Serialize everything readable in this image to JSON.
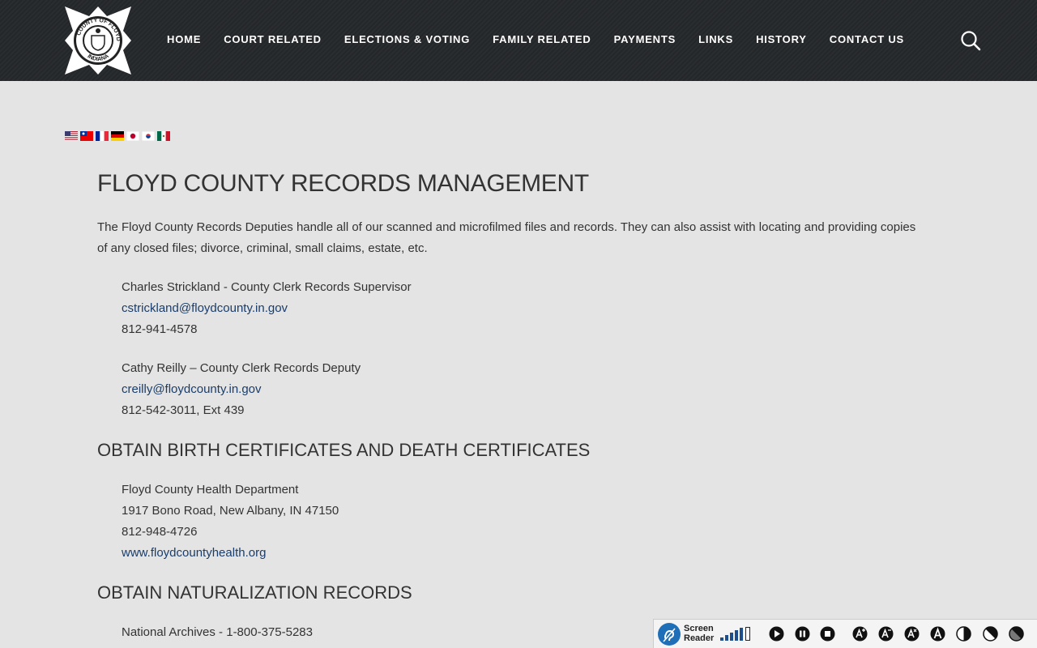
{
  "header": {
    "logo_text_top": "COUNTY OF FLOYD",
    "logo_text_bottom": "INDIANA",
    "nav": [
      "HOME",
      "COURT RELATED",
      "ELECTIONS & VOTING",
      "FAMILY RELATED",
      "PAYMENTS",
      "LINKS",
      "HISTORY",
      "CONTACT US"
    ]
  },
  "flags": [
    "english",
    "chinese-traditional",
    "french",
    "german",
    "japanese",
    "korean",
    "spanish"
  ],
  "page": {
    "title": "FLOYD COUNTY RECORDS MANAGEMENT",
    "intro": "The Floyd County Records Deputies handle all of our scanned and microfilmed files and records.  They can also assist with locating and providing copies of any closed files; divorce, criminal, small claims, estate, etc.",
    "contacts": [
      {
        "name": "Charles Strickland - County Clerk Records Supervisor",
        "email": "cstrickland@floydcounty.in.gov",
        "phone": "812-941-4578"
      },
      {
        "name": "Cathy Reilly – County Clerk Records Deputy",
        "email": "creilly@floydcounty.in.gov",
        "phone": "812-542-3011, Ext 439"
      }
    ],
    "birth_heading": "OBTAIN BIRTH CERTIFICATES AND DEATH CERTIFICATES",
    "health": {
      "name": "Floyd County Health Department",
      "address": "1917 Bono Road, New Albany, IN 47150",
      "phone": "812-948-4726",
      "website": "www.floydcountyhealth.org"
    },
    "naturalization_heading": "OBTAIN NATURALIZATION RECORDS",
    "archives": "National Archives - 1-800-375-5283"
  },
  "toolbar": {
    "label_line1": "Screen",
    "label_line2": "Reader"
  },
  "colors": {
    "header_bg": "#272a2c",
    "page_bg": "#e4e4e4",
    "link": "#1a3d6b",
    "toolbar_blue": "#1f4e8c"
  }
}
